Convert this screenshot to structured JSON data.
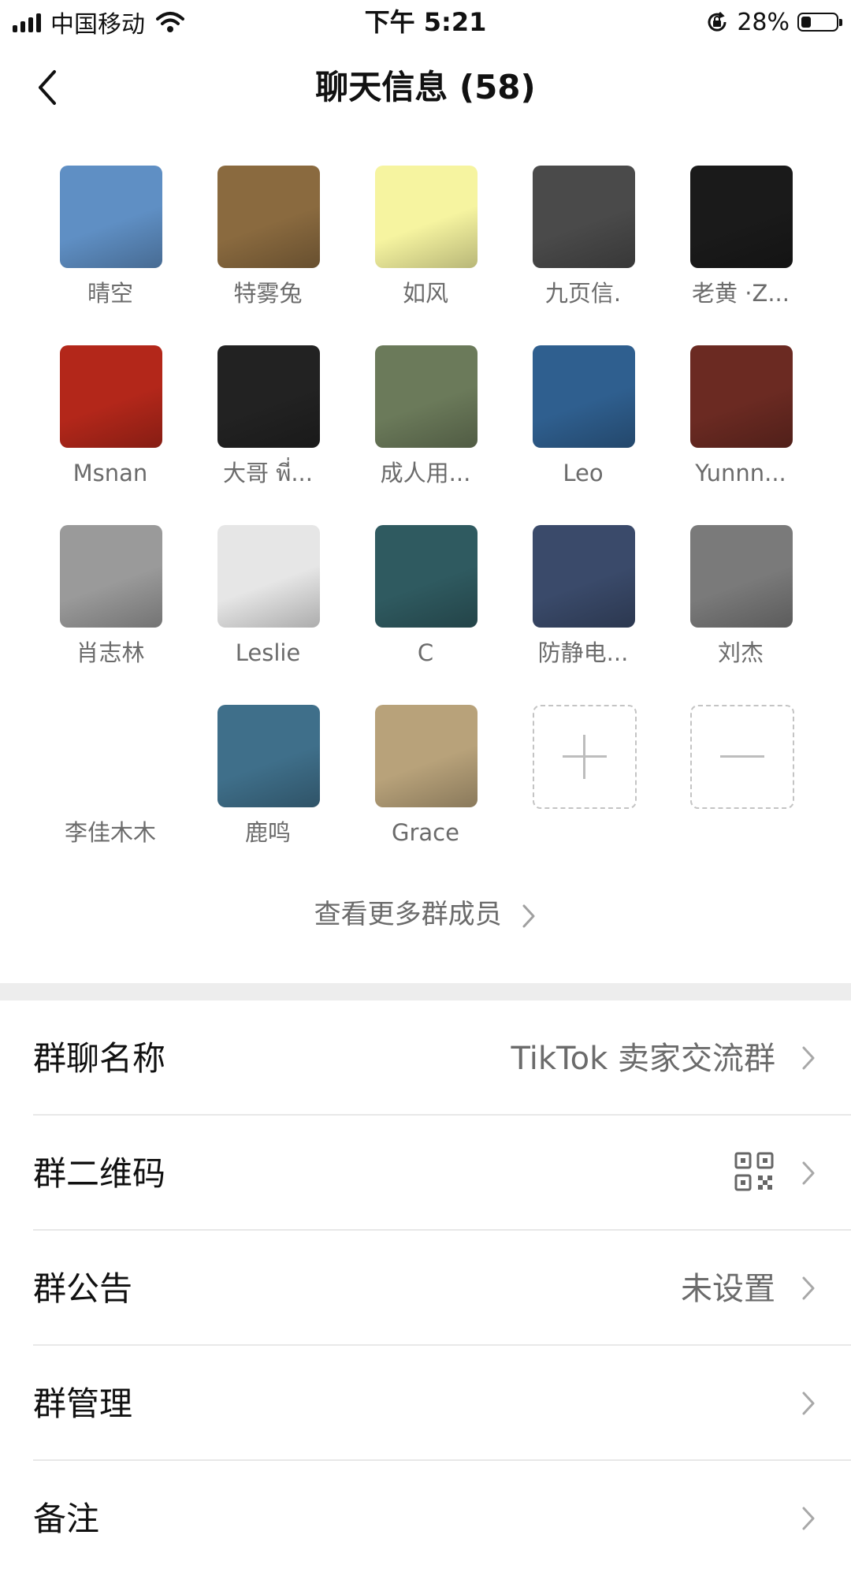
{
  "status_bar": {
    "carrier": "中国移动",
    "time": "下午 5:21",
    "battery_percent": "28%",
    "battery_level": 0.28,
    "icons": [
      "signal-icon",
      "wifi-icon",
      "orientation-lock-icon",
      "battery-icon"
    ]
  },
  "nav": {
    "title": "聊天信息 (58)",
    "back_icon": "chevron-left-icon"
  },
  "members": [
    {
      "name": "晴空",
      "color": "#5f8fc4"
    },
    {
      "name": "特雾兔",
      "color": "#8a6a3f"
    },
    {
      "name": "如风",
      "color": "#f6f4a0"
    },
    {
      "name": "九页信.",
      "color": "#4a4a4a"
    },
    {
      "name": "老黄 ·Z...",
      "color": "#1a1a1a"
    },
    {
      "name": "Msnan",
      "color": "#b3271a"
    },
    {
      "name": "大哥 พี่...",
      "color": "#222222"
    },
    {
      "name": "成人用...",
      "color": "#6b7a5a"
    },
    {
      "name": "Leo",
      "color": "#2f5f8f"
    },
    {
      "name": "Yunnn...",
      "color": "#6b2a22"
    },
    {
      "name": "肖志林",
      "color": "#9a9a9a"
    },
    {
      "name": "Leslie",
      "color": "#e6e6e6"
    },
    {
      "name": "C",
      "color": "#2f5a60"
    },
    {
      "name": "防静电...",
      "color": "#3a4a6a"
    },
    {
      "name": "刘杰",
      "color": "#7a7a7a"
    },
    {
      "name": "李佳木木",
      "color": "#ffffff"
    },
    {
      "name": "鹿鸣",
      "color": "#3f6f8a"
    },
    {
      "name": "Grace",
      "color": "#b8a27a"
    }
  ],
  "member_actions": {
    "add_icon": "plus-icon",
    "remove_icon": "minus-icon"
  },
  "more_members": "查看更多群成员",
  "settings": [
    {
      "label": "群聊名称",
      "value": "TikTok 卖家交流群"
    },
    {
      "label": "群二维码",
      "value": ""
    },
    {
      "label": "群公告",
      "value": "未设置"
    },
    {
      "label": "群管理",
      "value": ""
    },
    {
      "label": "备注",
      "value": ""
    }
  ]
}
